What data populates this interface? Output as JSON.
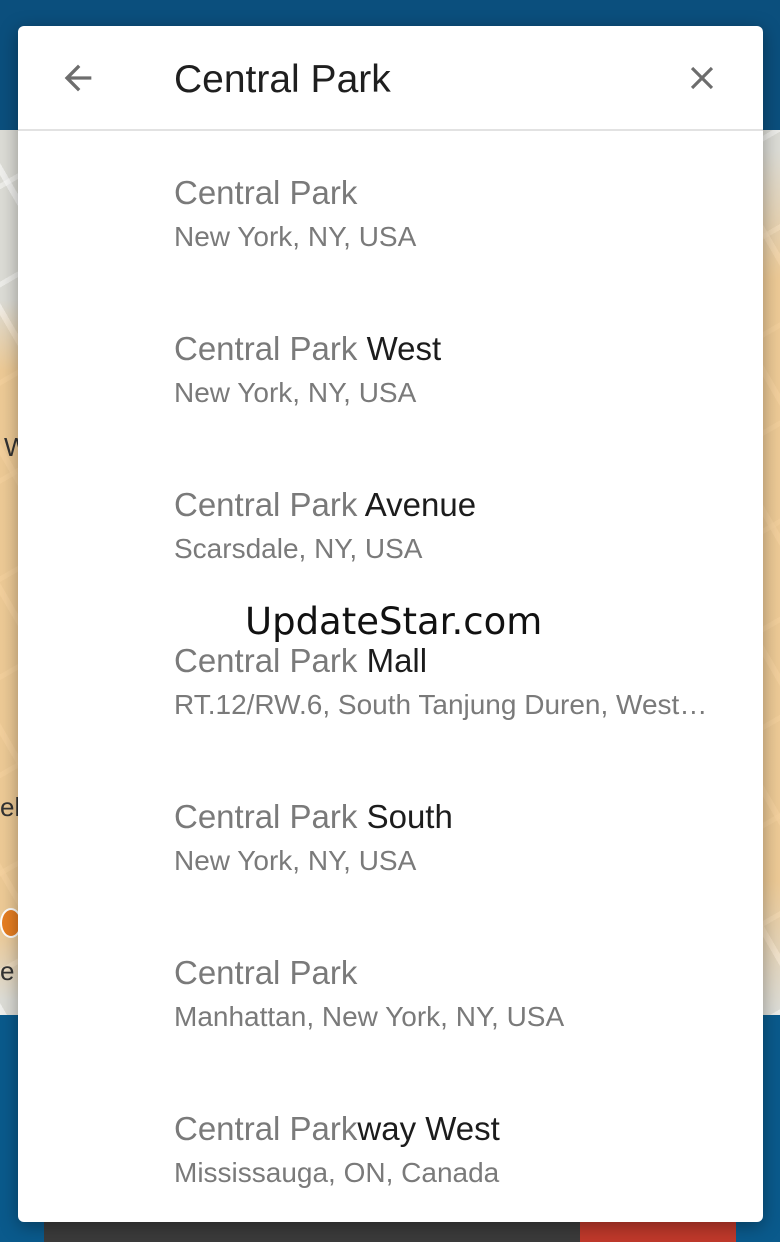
{
  "search": {
    "query": "Central Park",
    "back_icon": "arrow-left-icon",
    "clear_icon": "close-icon"
  },
  "results": [
    {
      "match": "Central Park",
      "rest": "",
      "subtitle": "New York, NY, USA"
    },
    {
      "match": "Central Park",
      "rest": " West",
      "subtitle": "New York, NY, USA"
    },
    {
      "match": "Central Park",
      "rest": " Avenue",
      "subtitle": "Scarsdale, NY, USA"
    },
    {
      "match": "Central Park",
      "rest": " Mall",
      "subtitle": "RT.12/RW.6, South Tanjung Duren, West…"
    },
    {
      "match": "Central Park",
      "rest": " South",
      "subtitle": "New York, NY, USA"
    },
    {
      "match": "Central Park",
      "rest": "",
      "subtitle": "Manhattan, New York, NY, USA"
    },
    {
      "match": "Central Park",
      "rest": "way West",
      "subtitle": "Mississauga, ON, Canada"
    }
  ],
  "watermark": "UpdateStar.com",
  "background": {
    "map_letters": [
      "W",
      "el",
      "e"
    ]
  },
  "colors": {
    "app_primary": "#0a5a8c",
    "match_text": "#7a7a7a",
    "title_text": "#1c1c1c"
  }
}
